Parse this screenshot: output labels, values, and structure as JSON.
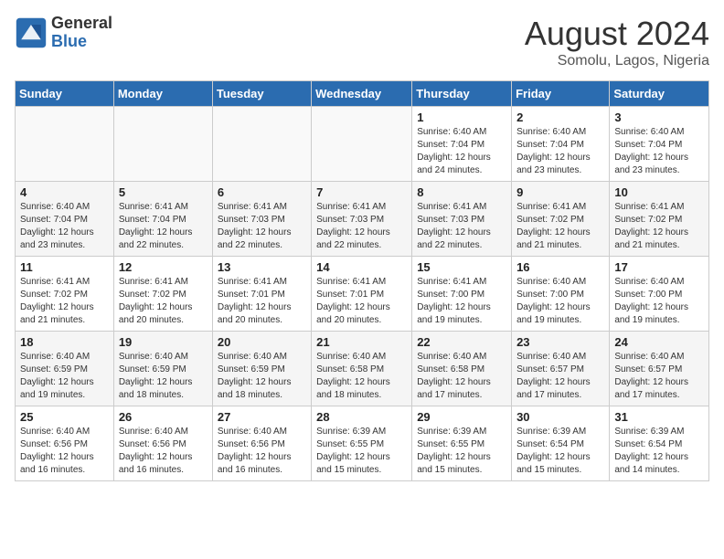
{
  "header": {
    "logo_general": "General",
    "logo_blue": "Blue",
    "month_year": "August 2024",
    "location": "Somolu, Lagos, Nigeria"
  },
  "weekdays": [
    "Sunday",
    "Monday",
    "Tuesday",
    "Wednesday",
    "Thursday",
    "Friday",
    "Saturday"
  ],
  "weeks": [
    [
      {
        "day": "",
        "info": ""
      },
      {
        "day": "",
        "info": ""
      },
      {
        "day": "",
        "info": ""
      },
      {
        "day": "",
        "info": ""
      },
      {
        "day": "1",
        "info": "Sunrise: 6:40 AM\nSunset: 7:04 PM\nDaylight: 12 hours\nand 24 minutes."
      },
      {
        "day": "2",
        "info": "Sunrise: 6:40 AM\nSunset: 7:04 PM\nDaylight: 12 hours\nand 23 minutes."
      },
      {
        "day": "3",
        "info": "Sunrise: 6:40 AM\nSunset: 7:04 PM\nDaylight: 12 hours\nand 23 minutes."
      }
    ],
    [
      {
        "day": "4",
        "info": "Sunrise: 6:40 AM\nSunset: 7:04 PM\nDaylight: 12 hours\nand 23 minutes."
      },
      {
        "day": "5",
        "info": "Sunrise: 6:41 AM\nSunset: 7:04 PM\nDaylight: 12 hours\nand 22 minutes."
      },
      {
        "day": "6",
        "info": "Sunrise: 6:41 AM\nSunset: 7:03 PM\nDaylight: 12 hours\nand 22 minutes."
      },
      {
        "day": "7",
        "info": "Sunrise: 6:41 AM\nSunset: 7:03 PM\nDaylight: 12 hours\nand 22 minutes."
      },
      {
        "day": "8",
        "info": "Sunrise: 6:41 AM\nSunset: 7:03 PM\nDaylight: 12 hours\nand 22 minutes."
      },
      {
        "day": "9",
        "info": "Sunrise: 6:41 AM\nSunset: 7:02 PM\nDaylight: 12 hours\nand 21 minutes."
      },
      {
        "day": "10",
        "info": "Sunrise: 6:41 AM\nSunset: 7:02 PM\nDaylight: 12 hours\nand 21 minutes."
      }
    ],
    [
      {
        "day": "11",
        "info": "Sunrise: 6:41 AM\nSunset: 7:02 PM\nDaylight: 12 hours\nand 21 minutes."
      },
      {
        "day": "12",
        "info": "Sunrise: 6:41 AM\nSunset: 7:02 PM\nDaylight: 12 hours\nand 20 minutes."
      },
      {
        "day": "13",
        "info": "Sunrise: 6:41 AM\nSunset: 7:01 PM\nDaylight: 12 hours\nand 20 minutes."
      },
      {
        "day": "14",
        "info": "Sunrise: 6:41 AM\nSunset: 7:01 PM\nDaylight: 12 hours\nand 20 minutes."
      },
      {
        "day": "15",
        "info": "Sunrise: 6:41 AM\nSunset: 7:00 PM\nDaylight: 12 hours\nand 19 minutes."
      },
      {
        "day": "16",
        "info": "Sunrise: 6:40 AM\nSunset: 7:00 PM\nDaylight: 12 hours\nand 19 minutes."
      },
      {
        "day": "17",
        "info": "Sunrise: 6:40 AM\nSunset: 7:00 PM\nDaylight: 12 hours\nand 19 minutes."
      }
    ],
    [
      {
        "day": "18",
        "info": "Sunrise: 6:40 AM\nSunset: 6:59 PM\nDaylight: 12 hours\nand 19 minutes."
      },
      {
        "day": "19",
        "info": "Sunrise: 6:40 AM\nSunset: 6:59 PM\nDaylight: 12 hours\nand 18 minutes."
      },
      {
        "day": "20",
        "info": "Sunrise: 6:40 AM\nSunset: 6:59 PM\nDaylight: 12 hours\nand 18 minutes."
      },
      {
        "day": "21",
        "info": "Sunrise: 6:40 AM\nSunset: 6:58 PM\nDaylight: 12 hours\nand 18 minutes."
      },
      {
        "day": "22",
        "info": "Sunrise: 6:40 AM\nSunset: 6:58 PM\nDaylight: 12 hours\nand 17 minutes."
      },
      {
        "day": "23",
        "info": "Sunrise: 6:40 AM\nSunset: 6:57 PM\nDaylight: 12 hours\nand 17 minutes."
      },
      {
        "day": "24",
        "info": "Sunrise: 6:40 AM\nSunset: 6:57 PM\nDaylight: 12 hours\nand 17 minutes."
      }
    ],
    [
      {
        "day": "25",
        "info": "Sunrise: 6:40 AM\nSunset: 6:56 PM\nDaylight: 12 hours\nand 16 minutes."
      },
      {
        "day": "26",
        "info": "Sunrise: 6:40 AM\nSunset: 6:56 PM\nDaylight: 12 hours\nand 16 minutes."
      },
      {
        "day": "27",
        "info": "Sunrise: 6:40 AM\nSunset: 6:56 PM\nDaylight: 12 hours\nand 16 minutes."
      },
      {
        "day": "28",
        "info": "Sunrise: 6:39 AM\nSunset: 6:55 PM\nDaylight: 12 hours\nand 15 minutes."
      },
      {
        "day": "29",
        "info": "Sunrise: 6:39 AM\nSunset: 6:55 PM\nDaylight: 12 hours\nand 15 minutes."
      },
      {
        "day": "30",
        "info": "Sunrise: 6:39 AM\nSunset: 6:54 PM\nDaylight: 12 hours\nand 15 minutes."
      },
      {
        "day": "31",
        "info": "Sunrise: 6:39 AM\nSunset: 6:54 PM\nDaylight: 12 hours\nand 14 minutes."
      }
    ]
  ]
}
